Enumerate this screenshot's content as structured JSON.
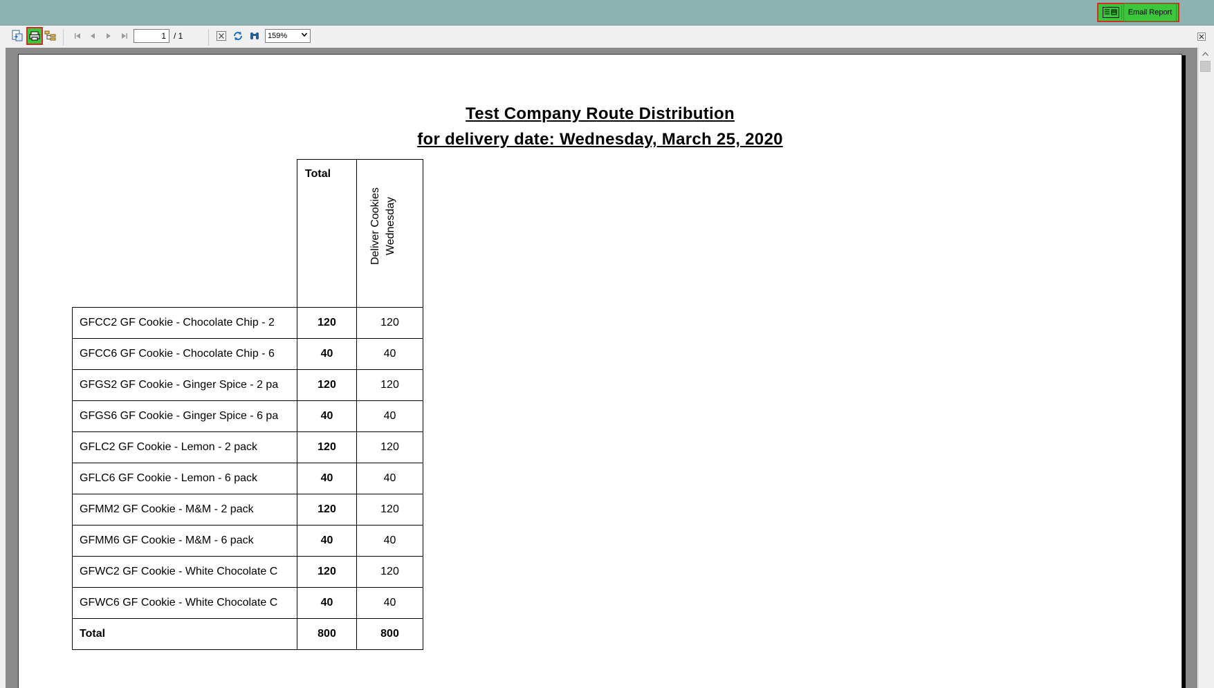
{
  "toolbar": {
    "export_icon": "export-icon",
    "print_icon": "print-icon",
    "group_tree_icon": "group-tree-icon",
    "first_page_icon": "first-page-icon",
    "prev_page_icon": "prev-page-icon",
    "next_page_icon": "next-page-icon",
    "last_page_icon": "last-page-icon",
    "current_page": "1",
    "page_total": "/ 1",
    "stop_icon": "stop-icon",
    "refresh_icon": "refresh-icon",
    "search_icon": "binoculars-icon",
    "zoom_value": "159%"
  },
  "header": {
    "email_icon": "email-icon",
    "email_button_label": "Email Report"
  },
  "report": {
    "title": "Test Company Route Distribution",
    "subtitle": "for delivery date: Wednesday, March 25, 2020",
    "columns": {
      "total": "Total",
      "route": "Deliver Cookies Wednesday"
    },
    "rows": [
      {
        "name": "GFCC2 GF Cookie - Chocolate Chip - 2",
        "total": "120",
        "value": "120"
      },
      {
        "name": "GFCC6 GF Cookie - Chocolate Chip - 6",
        "total": "40",
        "value": "40"
      },
      {
        "name": "GFGS2 GF Cookie - Ginger Spice - 2 pa",
        "total": "120",
        "value": "120"
      },
      {
        "name": "GFGS6 GF Cookie - Ginger Spice - 6 pa",
        "total": "40",
        "value": "40"
      },
      {
        "name": "GFLC2 GF Cookie - Lemon - 2 pack",
        "total": "120",
        "value": "120"
      },
      {
        "name": "GFLC6 GF Cookie - Lemon - 6 pack",
        "total": "40",
        "value": "40"
      },
      {
        "name": "GFMM2 GF Cookie - M&M - 2 pack",
        "total": "120",
        "value": "120"
      },
      {
        "name": "GFMM6 GF Cookie - M&M - 6 pack",
        "total": "40",
        "value": "40"
      },
      {
        "name": "GFWC2 GF Cookie - White Chocolate C",
        "total": "120",
        "value": "120"
      },
      {
        "name": "GFWC6 GF Cookie - White Chocolate C",
        "total": "40",
        "value": "40"
      }
    ],
    "total_row": {
      "name": "Total",
      "total": "800",
      "value": "800"
    }
  },
  "colors": {
    "titlebar": "#8db3b0",
    "highlight_green": "#3bc63b",
    "highlight_border": "#d42a2a"
  }
}
